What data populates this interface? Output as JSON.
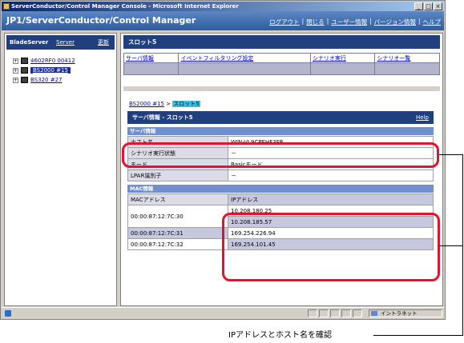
{
  "window": {
    "title": "ServerConductor/Control Manager Console - Microsoft Internet Explorer",
    "controls": [
      "_",
      "□",
      "×"
    ]
  },
  "app": {
    "title": "JP1/ServerConductor/Control Manager",
    "links": [
      "ログアウト",
      "閉じる",
      "ユーザー情報",
      "バージョン情報",
      "ヘルプ"
    ]
  },
  "left": {
    "header": {
      "a": "BladeServer",
      "b": "Server",
      "c": "更新"
    },
    "tree": [
      {
        "label": "4602RF0 00412",
        "selected": false
      },
      {
        "label": "BS2000 #15",
        "selected": true
      },
      {
        "label": "BS320 #27",
        "selected": false
      }
    ]
  },
  "right": {
    "header": "スロット5",
    "menu": [
      "サーバ情報",
      "イベントフィルタリング設定",
      "シナリオ実行",
      "シナリオ一覧"
    ],
    "breadcrumb": {
      "link": "BS2000 #15",
      "sep": ">",
      "current": "スロット5"
    },
    "info_header": "サーバ情報 - スロット5",
    "help": "Help",
    "server_section": "サーバ情報",
    "server_rows": [
      {
        "key": "ホスト名",
        "value": "WIN-VL9CPEHF3FR"
      },
      {
        "key": "シナリオ実行状態",
        "value": "－"
      },
      {
        "key": "モード",
        "value": "Basicモード"
      },
      {
        "key": "LPAR識別子",
        "value": "－"
      }
    ],
    "mac_section": "MAC情報",
    "mac_header": {
      "mac": "MACアドレス",
      "ip": "IPアドレス"
    },
    "mac_rows": [
      {
        "mac": "00:00:87:12:7C:30",
        "ips": [
          "10.208.180.25",
          "10.208.185.57"
        ]
      },
      {
        "mac": "00:00:87:12:7C:31",
        "ips": [
          "169.254.226.94"
        ]
      },
      {
        "mac": "00:00:87:12:7C:32",
        "ips": [
          "169.254.101.45"
        ]
      }
    ]
  },
  "status": {
    "zone": "イントラネット"
  },
  "annotation": {
    "caption": "IPアドレスとホスト名を確認",
    "color": "#e8102a"
  }
}
